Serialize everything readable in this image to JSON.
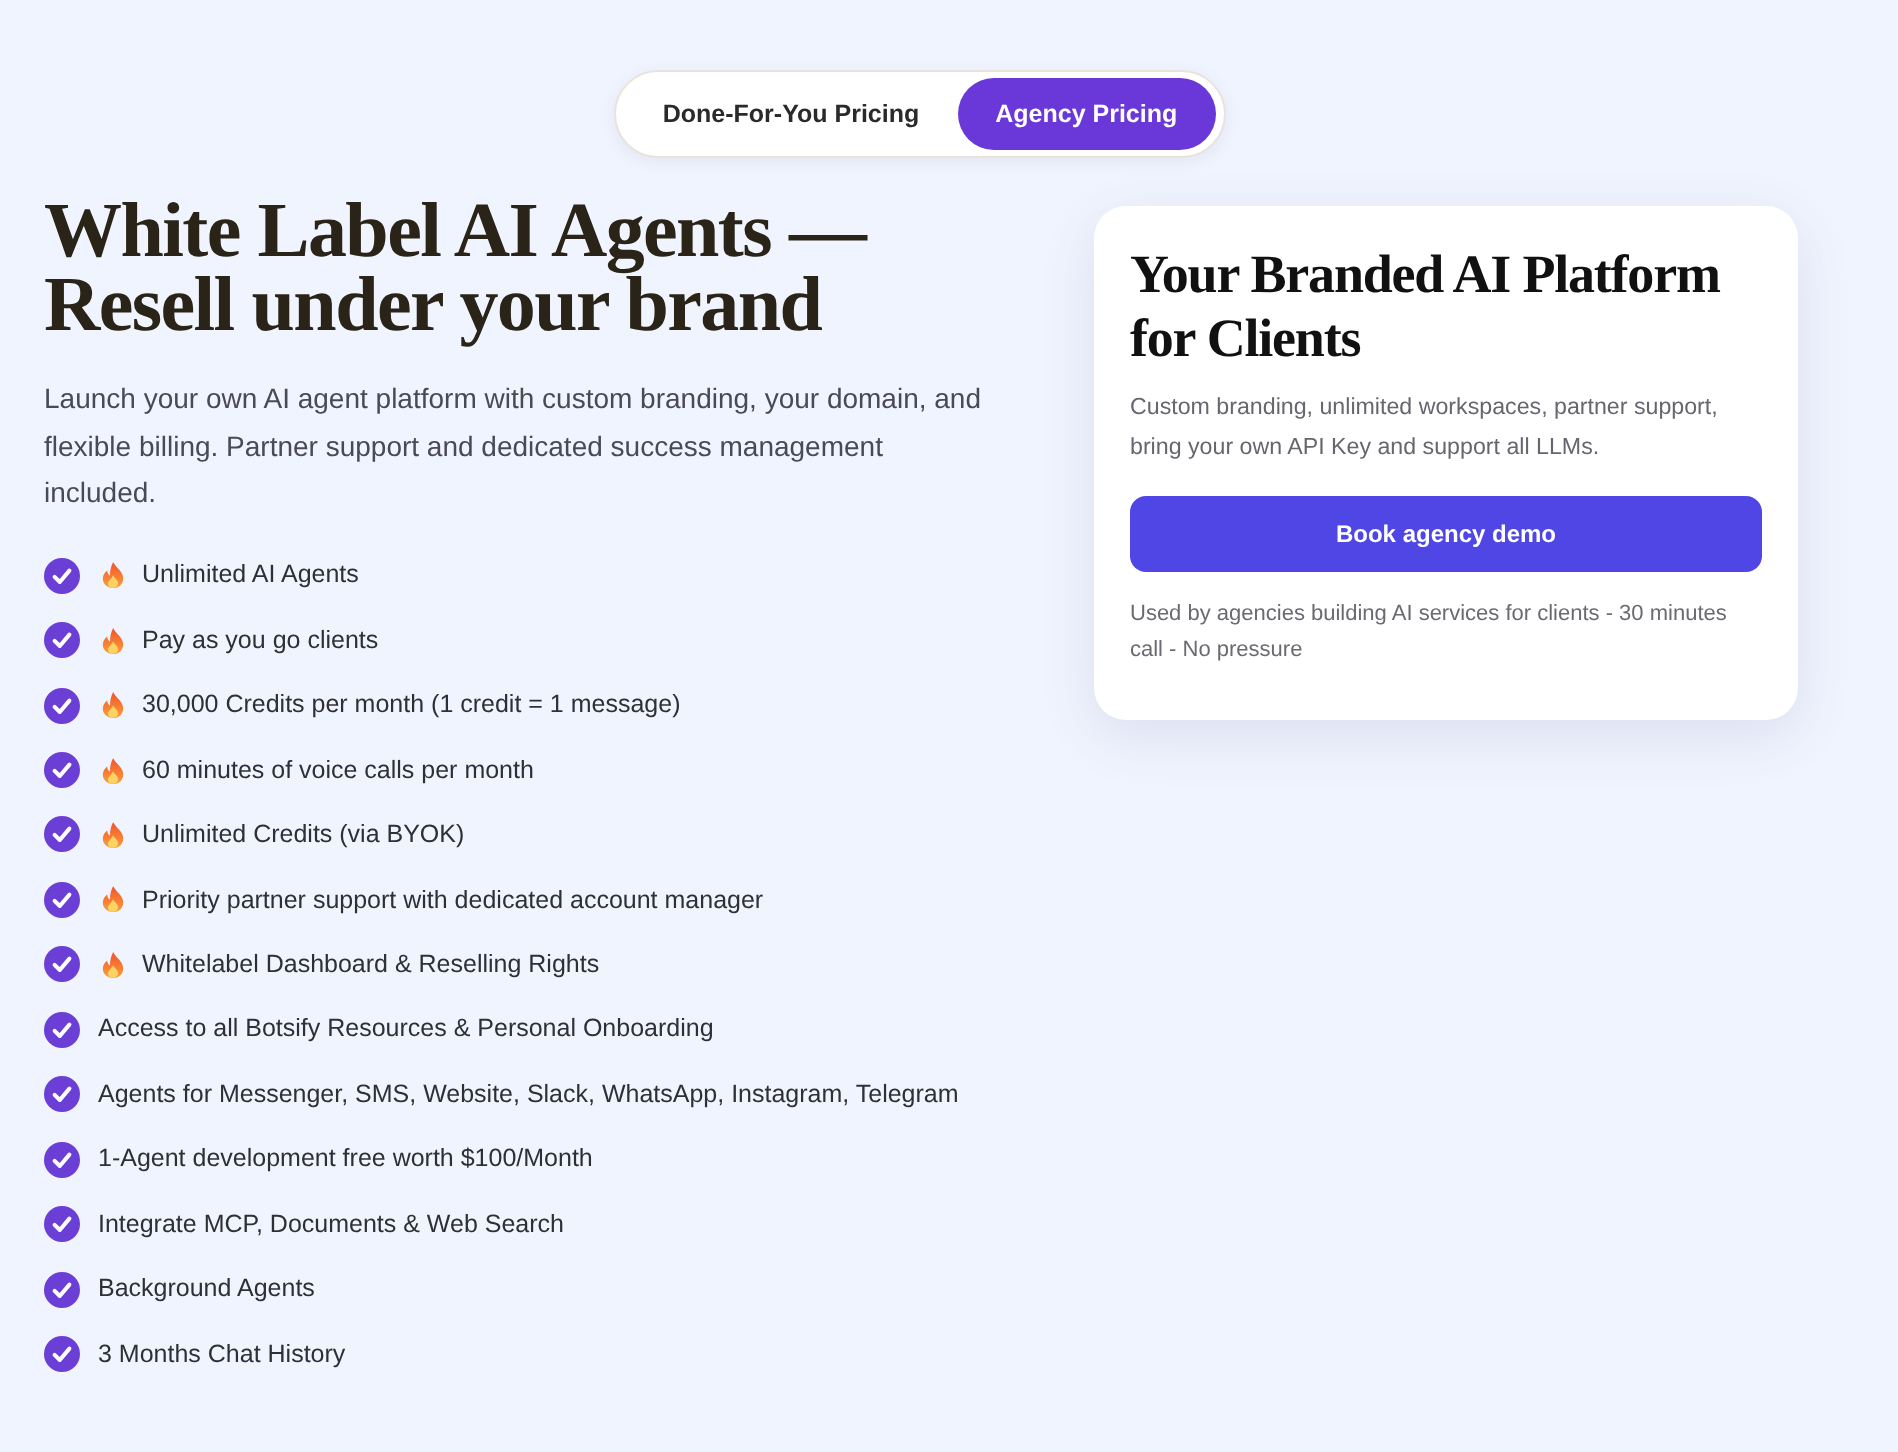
{
  "toggle": [
    {
      "label": "Done-For-You Pricing",
      "selected": false
    },
    {
      "label": "Agency Pricing",
      "selected": true
    }
  ],
  "hero": {
    "title": "White Label AI Agents — Resell under your brand",
    "description": "Launch your own AI agent platform with custom branding, your domain, and flexible billing. Partner support and dedicated success management included.",
    "features": [
      {
        "text": "Unlimited AI Agents",
        "hot": true
      },
      {
        "text": "Pay as you go clients",
        "hot": true
      },
      {
        "text": "30,000 Credits per month (1 credit = 1 message)",
        "hot": true
      },
      {
        "text": "60 minutes of voice calls per month",
        "hot": true
      },
      {
        "text": "Unlimited Credits (via BYOK)",
        "hot": true
      },
      {
        "text": "Priority partner support with dedicated account manager",
        "hot": true
      },
      {
        "text": "Whitelabel Dashboard & Reselling Rights",
        "hot": true
      },
      {
        "text": "Access to all Botsify Resources & Personal Onboarding",
        "hot": false
      },
      {
        "text": "Agents for Messenger, SMS, Website, Slack, WhatsApp, Instagram, Telegram",
        "hot": false
      },
      {
        "text": "1-Agent development free worth $100/Month",
        "hot": false
      },
      {
        "text": "Integrate MCP, Documents & Web Search",
        "hot": false
      },
      {
        "text": "Background Agents",
        "hot": false
      },
      {
        "text": "3 Months Chat History",
        "hot": false
      }
    ]
  },
  "card": {
    "title": "Your Branded AI Platform for Clients",
    "description": "Custom branding, unlimited workspaces, partner support, bring your own API Key and support all LLMs.",
    "button": "Book agency demo",
    "note": "Used by agencies building AI services for clients - 30 minutes call - No pressure"
  }
}
